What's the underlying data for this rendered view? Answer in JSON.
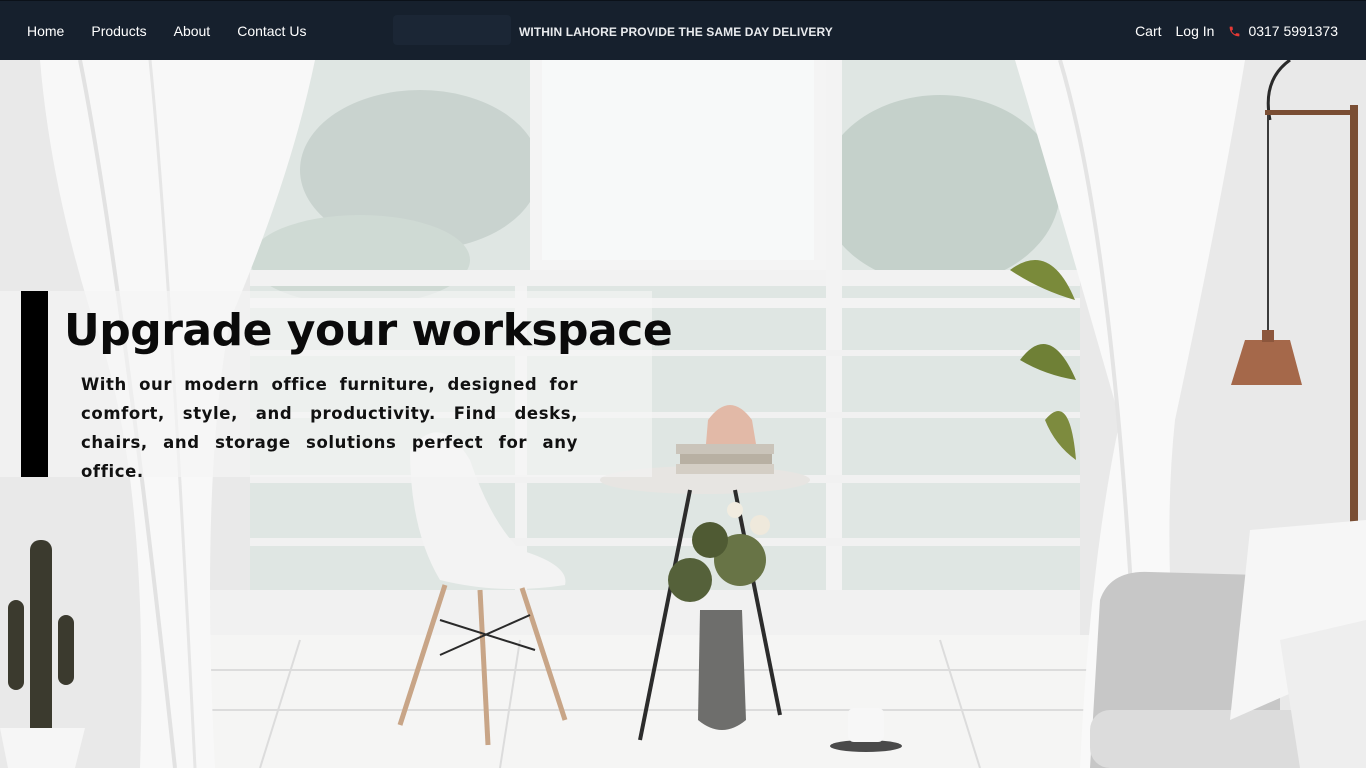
{
  "nav": {
    "links": [
      {
        "label": "Home"
      },
      {
        "label": "Products"
      },
      {
        "label": "About"
      },
      {
        "label": "Contact Us"
      }
    ],
    "announcement": "WITHIN LAHORE PROVIDE THE SAME DAY DELIVERY",
    "cart_label": "Cart",
    "login_label": "Log In",
    "phone": "0317 5991373",
    "phone_icon": "phone-icon",
    "phone_icon_color": "#e53935"
  },
  "hero": {
    "title": "Upgrade your workspace",
    "description": "With our modern office furniture, designed for comfort, style, and productivity. Find desks, chairs, and storage solutions perfect for any office.",
    "accent_color": "#000000"
  },
  "colors": {
    "navbar_bg": "#16202d",
    "nav_text": "#ffffff"
  }
}
